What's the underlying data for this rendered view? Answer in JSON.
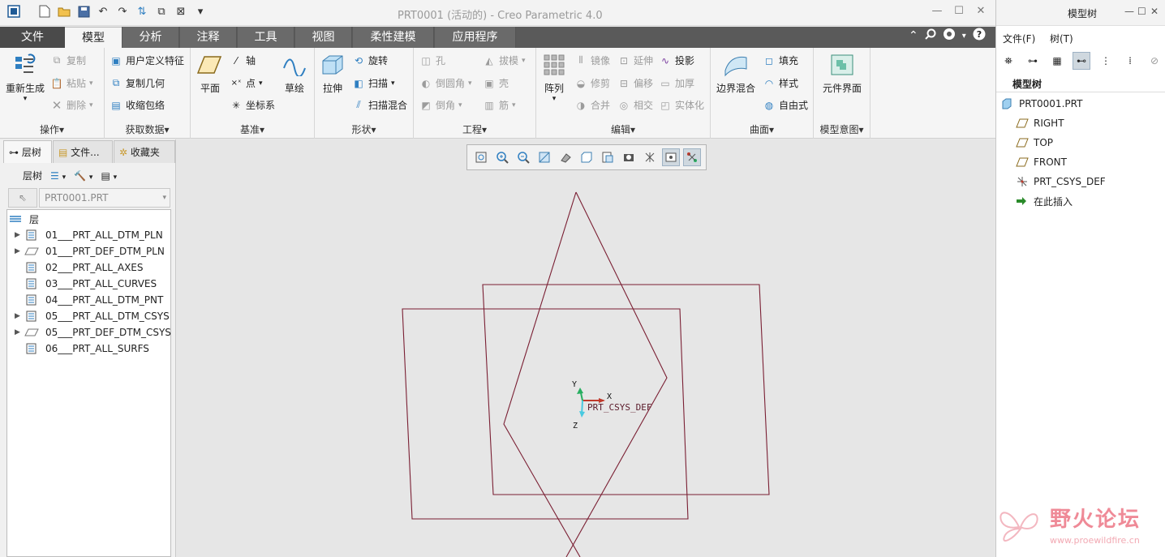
{
  "window": {
    "title": "PRT0001 (活动的) - Creo Parametric 4.0",
    "controls": [
      "—",
      "☐",
      "✕"
    ]
  },
  "tabs": [
    {
      "label": "文件"
    },
    {
      "label": "模型"
    },
    {
      "label": "分析"
    },
    {
      "label": "注释"
    },
    {
      "label": "工具"
    },
    {
      "label": "视图"
    },
    {
      "label": "柔性建模"
    },
    {
      "label": "应用程序"
    }
  ],
  "ribbon": {
    "groups": {
      "operations": "操作▾",
      "get_data": "获取数据▾",
      "datum": "基准▾",
      "shapes": "形状▾",
      "engineering": "工程▾",
      "editing": "编辑▾",
      "surfaces": "曲面▾",
      "model_intent": "模型意图▾"
    },
    "regenerate": "重新生成",
    "copy": "复制",
    "paste": "粘贴",
    "delete": "删除",
    "udf": "用户定义特征",
    "copy_geom": "复制几何",
    "shrinkwrap": "收缩包络",
    "plane": "平面",
    "axis": "轴",
    "point": "点",
    "csys": "坐标系",
    "sketch": "草绘",
    "extrude": "拉伸",
    "revolve": "旋转",
    "sweep": "扫描",
    "swept_blend": "扫描混合",
    "hole": "孔",
    "round": "倒圆角",
    "chamfer": "倒角",
    "draft": "拔模",
    "shell": "壳",
    "rib": "筋",
    "pattern": "阵列",
    "mirror": "镜像",
    "trim": "修剪",
    "merge": "合并",
    "extend": "延伸",
    "offset": "偏移",
    "intersect": "相交",
    "project": "投影",
    "thicken": "加厚",
    "solidify": "实体化",
    "boundary_blend": "边界混合",
    "fill": "填充",
    "style": "样式",
    "freestyle": "自由式",
    "component_interface": "元件界面"
  },
  "left_panel": {
    "tabs": [
      "层树",
      "文件...",
      "收藏夹"
    ],
    "toolbar_label": "层树",
    "path": "PRT0001.PRT",
    "root": "层",
    "layers": [
      {
        "name": "01___PRT_ALL_DTM_PLN",
        "expandable": true,
        "type": "layer"
      },
      {
        "name": "01___PRT_DEF_DTM_PLN",
        "expandable": true,
        "type": "default"
      },
      {
        "name": "02___PRT_ALL_AXES",
        "expandable": false,
        "type": "layer"
      },
      {
        "name": "03___PRT_ALL_CURVES",
        "expandable": false,
        "type": "layer"
      },
      {
        "name": "04___PRT_ALL_DTM_PNT",
        "expandable": false,
        "type": "layer"
      },
      {
        "name": "05___PRT_ALL_DTM_CSYS",
        "expandable": true,
        "type": "layer"
      },
      {
        "name": "05___PRT_DEF_DTM_CSYS",
        "expandable": true,
        "type": "default"
      },
      {
        "name": "06___PRT_ALL_SURFS",
        "expandable": false,
        "type": "layer"
      }
    ]
  },
  "graphics": {
    "csys_label": "PRT_CSYS_DEF",
    "axis_x": "X",
    "axis_y": "Y",
    "axis_z": "Z"
  },
  "model_tree": {
    "title": "模型树",
    "menu_file": "文件(F)",
    "menu_tree": "树(T)",
    "header": "模型树",
    "items": [
      {
        "label": "PRT0001.PRT",
        "icon": "part-icon"
      },
      {
        "label": "RIGHT",
        "icon": "datum-plane-icon"
      },
      {
        "label": "TOP",
        "icon": "datum-plane-icon"
      },
      {
        "label": "FRONT",
        "icon": "datum-plane-icon"
      },
      {
        "label": "PRT_CSYS_DEF",
        "icon": "csys-icon"
      },
      {
        "label": "在此插入",
        "icon": "insert-arrow-icon"
      }
    ]
  },
  "watermark": {
    "title": "野火论坛",
    "url": "www.proewildfire.cn"
  },
  "colors": {
    "tab_bar": "#5a5a5a",
    "datum_plane": "#7a1f33",
    "watermark": "#e86a7a"
  }
}
